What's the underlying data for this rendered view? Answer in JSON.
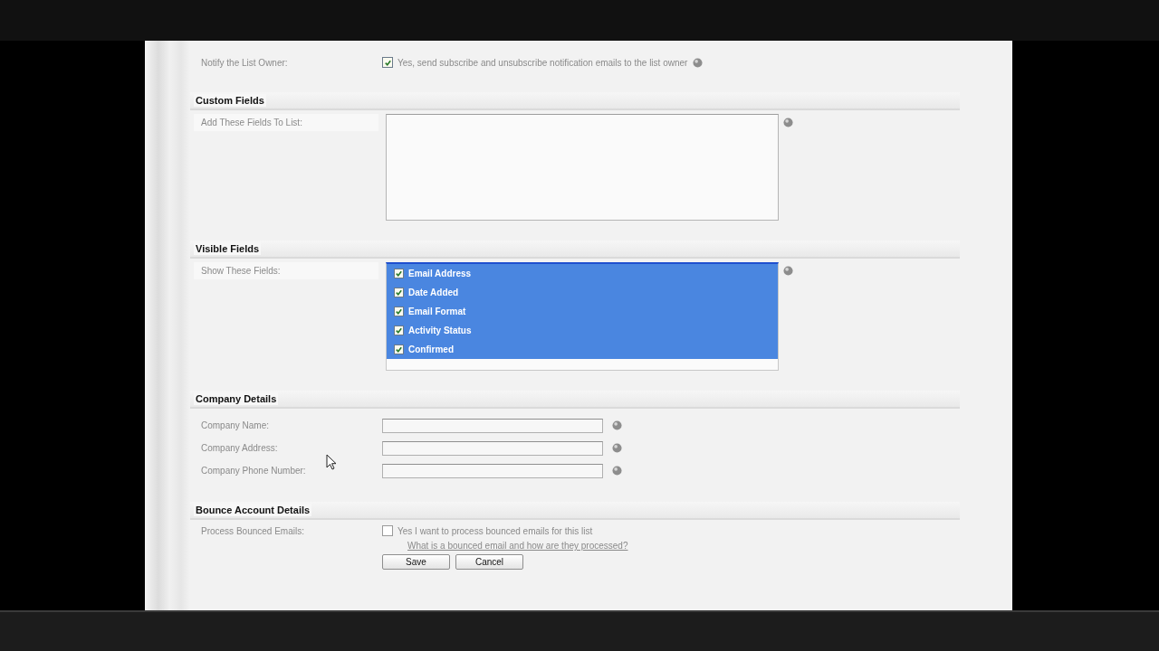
{
  "notify_row": {
    "label": "Notify the List Owner:",
    "checkbox": {
      "checked": true,
      "label": "Yes, send subscribe and unsubscribe notification emails to the list owner"
    }
  },
  "sections": [
    {
      "title": "Custom Fields",
      "rows": [
        {
          "kind": "textarea",
          "label": "Add These Fields To List:"
        }
      ]
    },
    {
      "title": "Visible Fields",
      "rows": [
        {
          "kind": "listbox",
          "label": "Show These Fields:",
          "items": [
            {
              "label": "Email Address",
              "checked": true,
              "selected": true
            },
            {
              "label": "Date Added",
              "checked": true,
              "selected": true
            },
            {
              "label": "Email Format",
              "checked": true,
              "selected": true
            },
            {
              "label": "Activity Status",
              "checked": true,
              "selected": true
            },
            {
              "label": "Confirmed",
              "checked": true,
              "selected": true
            }
          ]
        }
      ]
    },
    {
      "title": "Company Details",
      "rows": [
        {
          "kind": "text",
          "label": "Company Name:"
        },
        {
          "kind": "text",
          "label": "Company Address:"
        },
        {
          "kind": "text",
          "label": "Company Phone Number:"
        }
      ]
    },
    {
      "title": "Bounce Account Details",
      "rows": [
        {
          "kind": "checkbox",
          "label": "Process Bounced Emails:",
          "checked": false,
          "text": "Yes I want to process bounced emails for this list",
          "link": "What is a bounced email and how are they processed?"
        }
      ]
    }
  ],
  "buttons": [
    "Save",
    "Cancel"
  ]
}
